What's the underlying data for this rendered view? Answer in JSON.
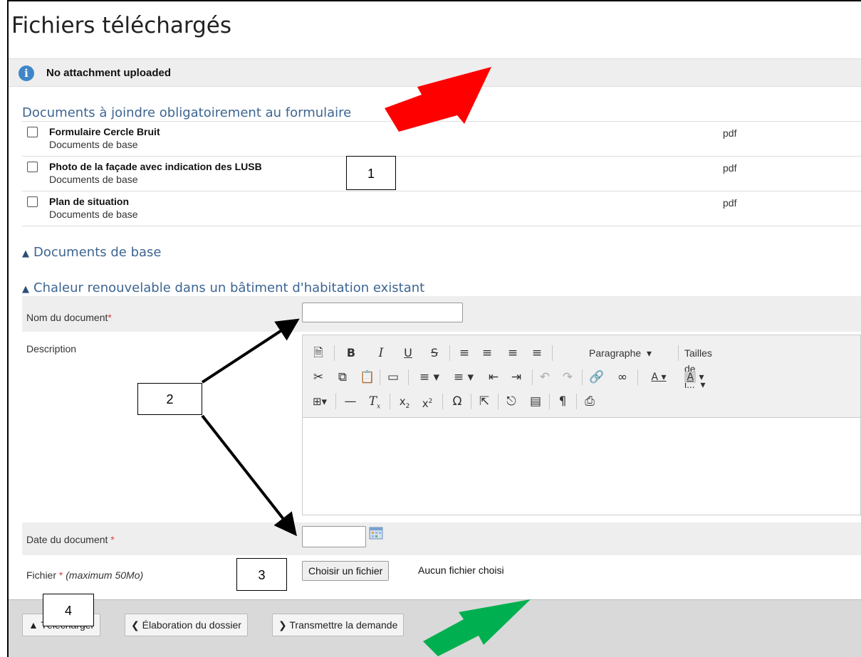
{
  "page": {
    "title": "Fichiers téléchargés",
    "info_message": "No attachment uploaded"
  },
  "required_docs": {
    "heading": "Documents à joindre obligatoirement au formulaire",
    "rows": [
      {
        "name": "Formulaire Cercle Bruit",
        "category": "Documents de base",
        "type": "pdf"
      },
      {
        "name": "Photo de la façade avec indication des LUSB",
        "category": "Documents de base",
        "type": "pdf"
      },
      {
        "name": "Plan de situation",
        "category": "Documents de base",
        "type": "pdf"
      }
    ]
  },
  "sections": {
    "base_docs": "Documents de base",
    "renewable": "Chaleur renouvelable dans un bâtiment d'habitation existant"
  },
  "form": {
    "doc_name_label": "Nom du document",
    "doc_name_value": "",
    "description_label": "Description",
    "date_label": "Date du document ",
    "date_value": "",
    "file_label": "Fichier ",
    "file_hint": "(maximum 50Mo)",
    "required_mark": "*",
    "file_button": "Choisir un fichier",
    "file_status": "Aucun fichier choisi"
  },
  "editor": {
    "paragraph_select": "Paragraphe",
    "size_select": "Tailles de l...",
    "icons": [
      "new-page-icon",
      "bold-icon",
      "italic-icon",
      "underline-icon",
      "strikethrough-icon",
      "align-left-icon",
      "align-center-icon",
      "align-right-icon",
      "justify-icon",
      "cut-icon",
      "copy-icon",
      "paste-icon",
      "find-icon",
      "bullet-list-icon",
      "numbered-list-icon",
      "outdent-icon",
      "indent-icon",
      "undo-icon",
      "redo-icon",
      "link-icon",
      "unlink-icon",
      "text-color-icon",
      "background-color-icon",
      "table-icon",
      "horizontal-line-icon",
      "remove-format-icon",
      "subscript-icon",
      "superscript-icon",
      "special-char-icon",
      "fullscreen-icon",
      "insert-icon",
      "page-break-icon",
      "show-blocks-icon",
      "print-icon"
    ]
  },
  "actions": {
    "upload": "Télécharger",
    "back": "Élaboration du dossier",
    "submit": "Transmettre la demande"
  },
  "annotations": {
    "callout_1": "1",
    "callout_2": "2",
    "callout_3": "3",
    "callout_4": "4",
    "red_arrow_color": "#ff0000",
    "green_arrow_color": "#00b050",
    "black_arrow_color": "#000000"
  }
}
